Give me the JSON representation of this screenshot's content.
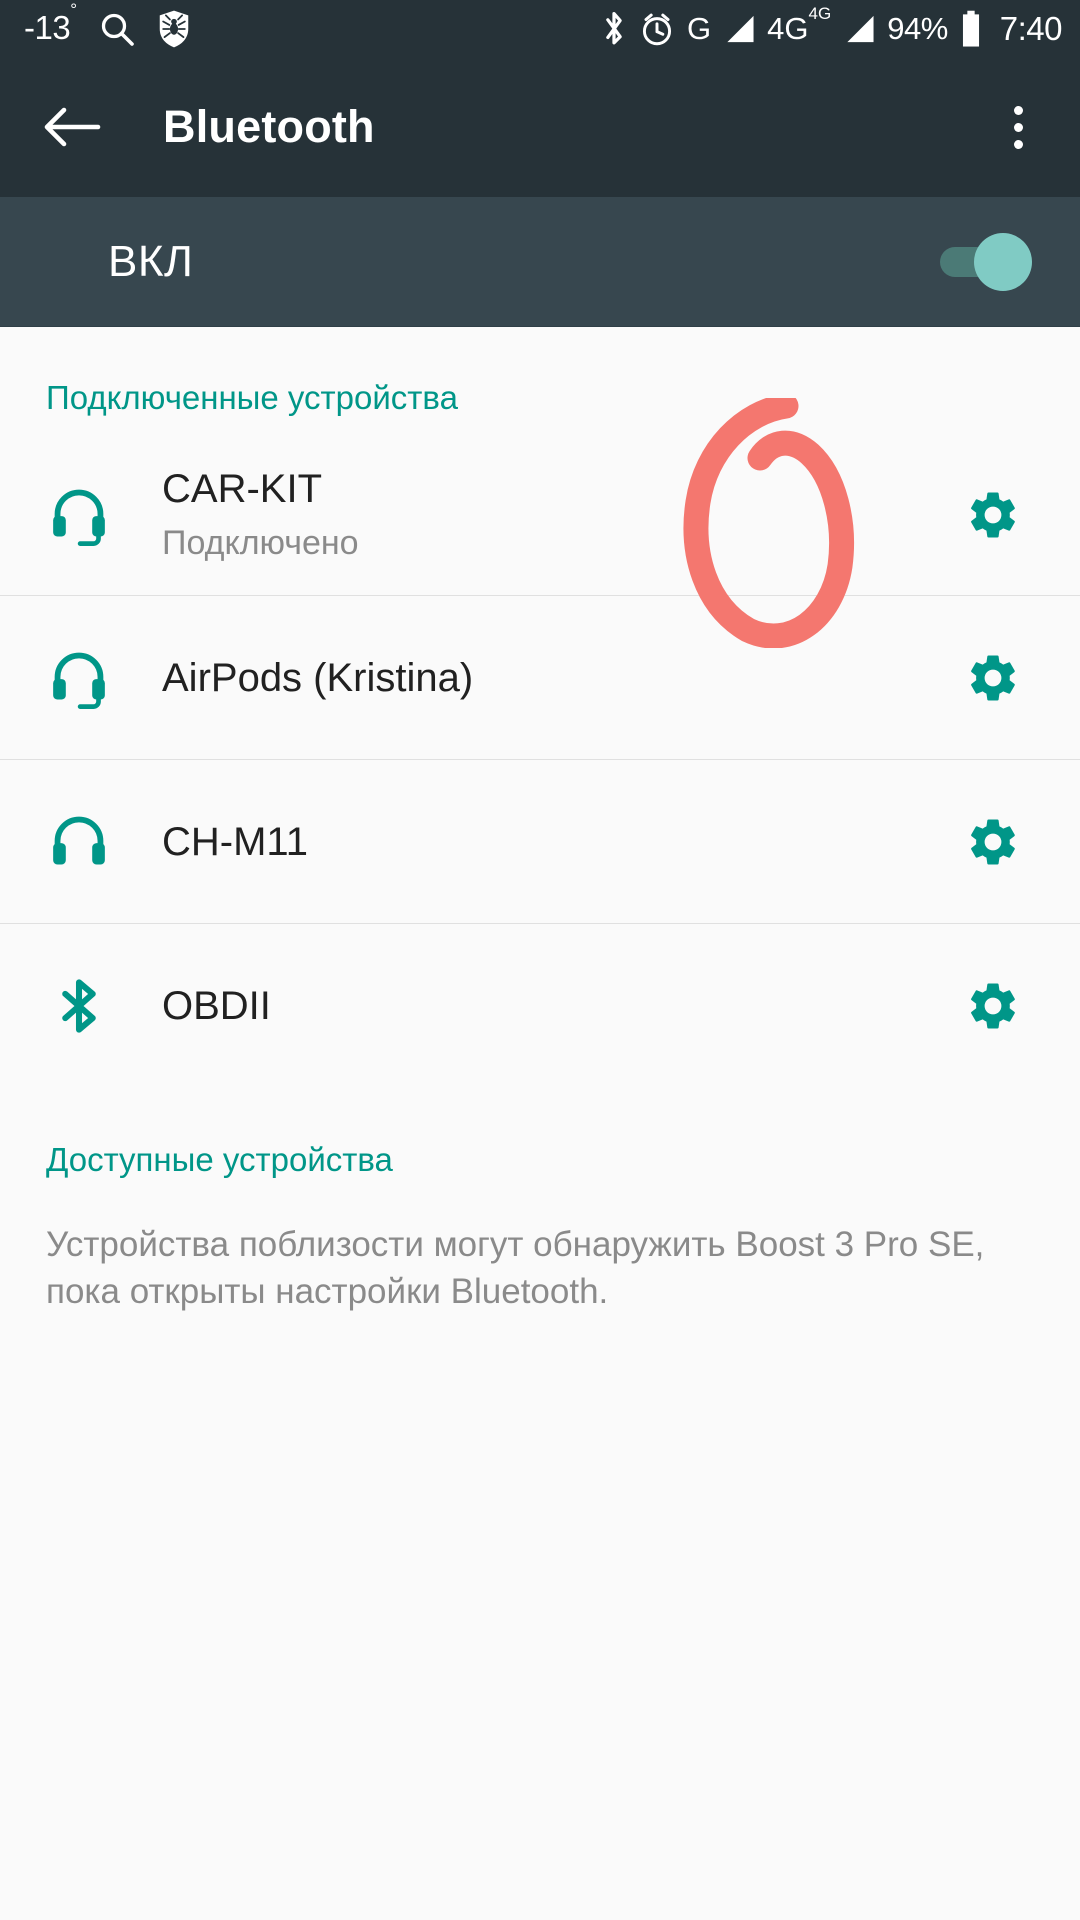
{
  "status_bar": {
    "temperature": "-13",
    "degree": "°",
    "icons": [
      {
        "name": "search-icon",
        "label": "search"
      },
      {
        "name": "drweb-spider-icon",
        "label": "Dr.Web"
      },
      {
        "name": "bluetooth-icon",
        "label": "bluetooth"
      },
      {
        "name": "alarm-icon",
        "label": "alarm"
      }
    ],
    "network_1": "G",
    "network_2": "4G",
    "network_2_sup": "4G",
    "battery_percent": "94%",
    "clock": "7:40"
  },
  "app_bar": {
    "back_label": "Назад",
    "title": "Bluetooth",
    "overflow_label": "Ещё"
  },
  "master_switch": {
    "label": "ВКЛ",
    "state": "on"
  },
  "connected_section": {
    "header": "Подключенные устройства",
    "devices": [
      {
        "name": "CAR-KIT",
        "status": "Подключено",
        "icon": "headset-icon",
        "gear_label": "Настройки"
      },
      {
        "name": "AirPods (Kristina)",
        "status": "",
        "icon": "headset-icon",
        "gear_label": "Настройки"
      },
      {
        "name": "CH-M11",
        "status": "",
        "icon": "headphones-icon",
        "gear_label": "Настройки"
      },
      {
        "name": "OBDII",
        "status": "",
        "icon": "bluetooth-icon",
        "gear_label": "Настройки"
      }
    ]
  },
  "available_section": {
    "header": "Доступные устройства",
    "description": "Устройства поблизости могут обнаружить Boost 3 Pro SE, пока открыты настройки Bluetooth."
  },
  "annotation": {
    "shape": "hand-drawn-circle",
    "color": "#f4776f",
    "target": "gear-icon of CAR-KIT"
  },
  "colors": {
    "status_bar_bg": "#263238",
    "app_bar_bg": "#263238",
    "switch_bg": "#37474f",
    "accent_teal": "#009688",
    "toggle_thumb": "#80cbc4",
    "page_bg": "#fafafa",
    "primary_text": "#212121",
    "secondary_text": "#8a8a8a",
    "annotation_red": "#f4776f"
  }
}
